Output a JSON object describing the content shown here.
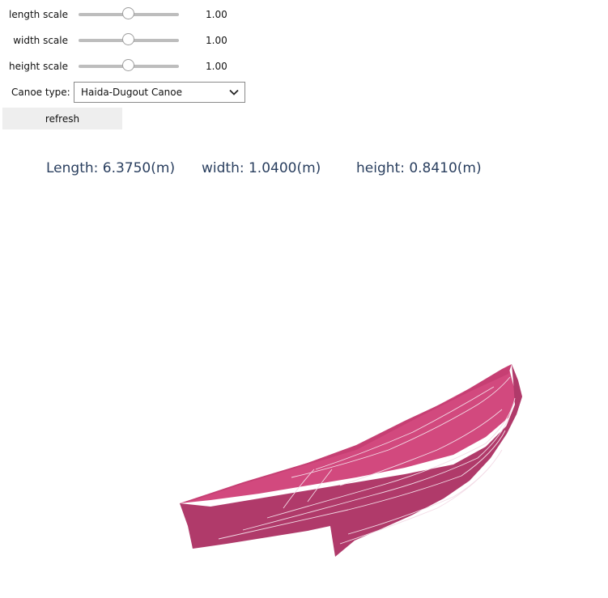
{
  "controls": {
    "sliders": [
      {
        "label": "length scale",
        "value": 1.0,
        "value_text": "1.00",
        "fraction": 0.5
      },
      {
        "label": "width scale",
        "value": 1.0,
        "value_text": "1.00",
        "fraction": 0.5
      },
      {
        "label": "height scale",
        "value": 1.0,
        "value_text": "1.00",
        "fraction": 0.5
      }
    ],
    "canoe_type_label": "Canoe type:",
    "canoe_type_selected": "Haida-Dugout Canoe",
    "refresh_label": "refresh"
  },
  "dimensions": {
    "length": "Length: 6.3750(m)",
    "width": "width: 1.0400(m)",
    "height": "height: 0.8410(m)"
  },
  "colors": {
    "hull_outer": "#b03a6a",
    "hull_inner": "#d2497e",
    "hull_rim": "#c63f73",
    "contour": "#f3dbe6",
    "text_accent": "#2a3f5f"
  }
}
